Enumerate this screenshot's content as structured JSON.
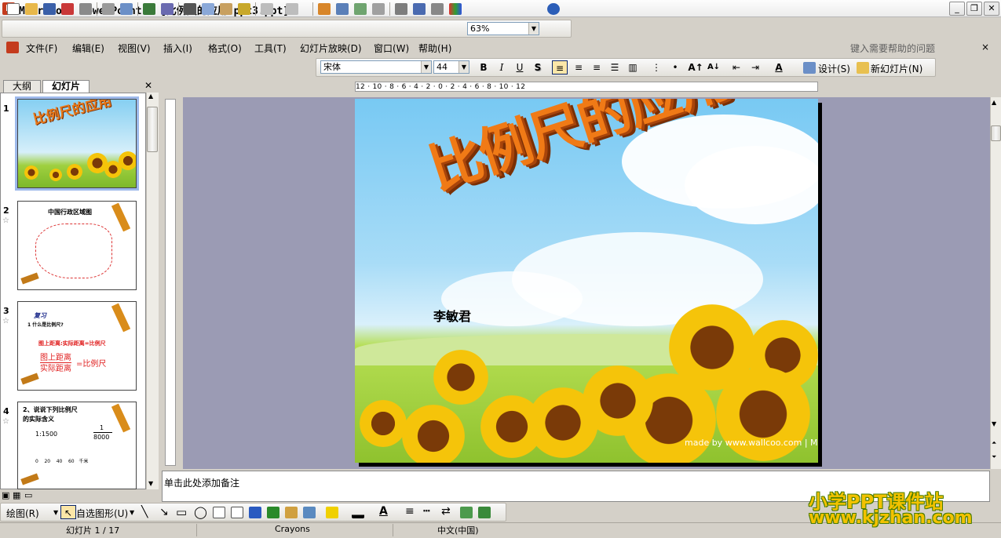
{
  "window": {
    "title": "Microsoft PowerPoint - [比例尺的应用.ppt3.ppt]",
    "app_icon_letter": "P"
  },
  "toolbar": {
    "zoom": "63%"
  },
  "menu": {
    "items": [
      "文件(F)",
      "编辑(E)",
      "视图(V)",
      "插入(I)",
      "格式(O)",
      "工具(T)",
      "幻灯片放映(D)",
      "窗口(W)",
      "帮助(H)"
    ],
    "help_placeholder": "键入需要帮助的问题"
  },
  "format_toolbar": {
    "font_name": "宋体",
    "font_size": "44",
    "bold": "B",
    "italic": "I",
    "underline": "U",
    "shadow": "S",
    "design_label": "设计(S)",
    "new_slide_label": "新幻灯片(N)"
  },
  "left_panel": {
    "tabs": [
      "大纲",
      "幻灯片"
    ],
    "thumbnails": [
      {
        "num": "1",
        "title": "比例尺的应用"
      },
      {
        "num": "2",
        "title": "中国行政区域图"
      },
      {
        "num": "3",
        "title": "复习",
        "line1": "1  什么是比例尺?",
        "line2": "图上距离:实际距离=比例尺",
        "line3": "图上距离",
        "line4": "实际距离",
        "line5": "=比例尺"
      },
      {
        "num": "4",
        "title": "2、说说下列比例尺",
        "line1": "的实际含义",
        "line2": "1:1500",
        "line3": "1",
        "line4": "8000",
        "line5": "0    20    40    60   千米"
      }
    ]
  },
  "ruler": {
    "horizontal": "12 · 10 · 8 · 6 · 4 · 2 · 0 · 2 · 4 · 6 · 8 · 10 · 12"
  },
  "slide": {
    "title": "比例尺的应用",
    "author": "李敏君",
    "watermark": "made by www.wallcoo.com | March"
  },
  "notes": {
    "placeholder": "单击此处添加备注"
  },
  "draw_toolbar": {
    "draw_label": "绘图(R)",
    "autoshapes_label": "自选图形(U)"
  },
  "statusbar": {
    "slide_info": "幻灯片 1 / 17",
    "design": "Crayons",
    "language": "中文(中国)"
  },
  "brand": {
    "line1": "小学PPT课件站",
    "line2": "www.kjzhan.com"
  }
}
